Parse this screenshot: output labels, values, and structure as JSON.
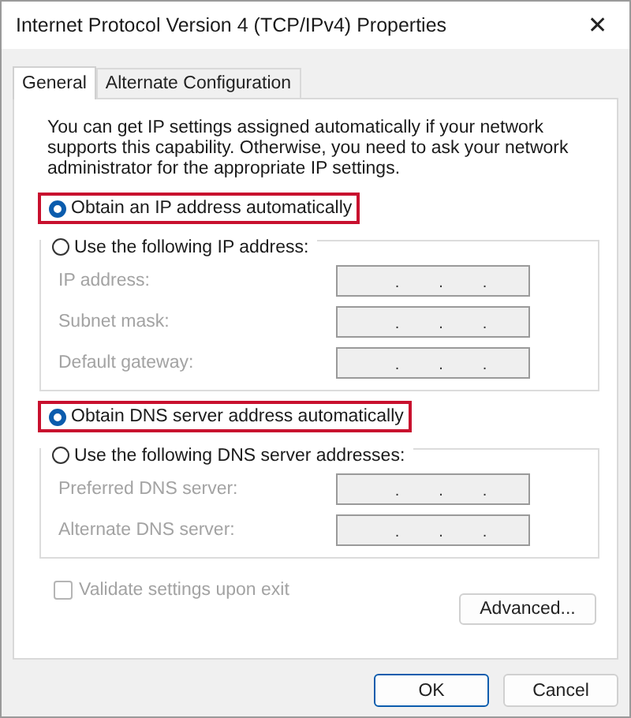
{
  "window": {
    "title": "Internet Protocol Version 4 (TCP/IPv4) Properties",
    "close": "✕"
  },
  "tabs": [
    {
      "label": "General",
      "selected": true
    },
    {
      "label": "Alternate Configuration",
      "selected": false
    }
  ],
  "description": "You can get IP settings assigned automatically if your network supports this capability. Otherwise, you need to ask your network administrator for the appropriate IP settings.",
  "ip_section": {
    "auto_option": {
      "label": "Obtain an IP address automatically",
      "selected": true,
      "highlighted": true
    },
    "manual_option": {
      "label": "Use the following IP address:",
      "selected": false,
      "highlighted": false
    },
    "fields": [
      {
        "label": "IP address:",
        "disabled": true,
        "separators": [
          ".",
          ".",
          "."
        ]
      },
      {
        "label": "Subnet mask:",
        "disabled": true,
        "separators": [
          ".",
          ".",
          "."
        ]
      },
      {
        "label": "Default gateway:",
        "disabled": true,
        "separators": [
          ".",
          ".",
          "."
        ]
      }
    ]
  },
  "dns_section": {
    "auto_option": {
      "label": "Obtain DNS server address automatically",
      "selected": true,
      "highlighted": true
    },
    "manual_option": {
      "label": "Use the following DNS server addresses:",
      "selected": false,
      "highlighted": false
    },
    "fields": [
      {
        "label": "Preferred DNS server:",
        "disabled": true,
        "separators": [
          ".",
          ".",
          "."
        ]
      },
      {
        "label": "Alternate DNS server:",
        "disabled": true,
        "separators": [
          ".",
          ".",
          "."
        ]
      }
    ]
  },
  "validate": {
    "label": "Validate settings upon exit",
    "checked": false,
    "disabled": true
  },
  "advanced_button": "Advanced...",
  "buttons": [
    {
      "label": "OK",
      "default": true
    },
    {
      "label": "Cancel",
      "default": false
    }
  ]
}
